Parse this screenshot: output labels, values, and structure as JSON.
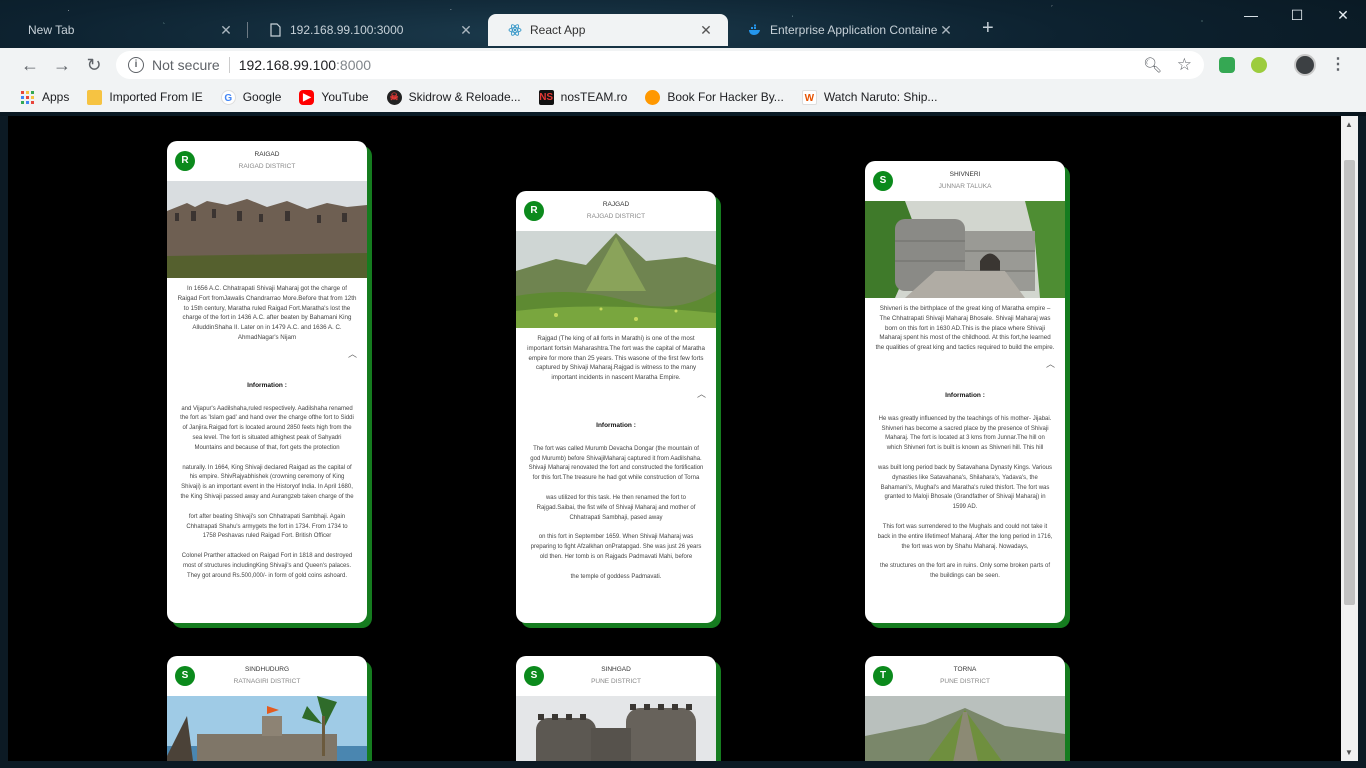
{
  "browser": {
    "tabs": [
      {
        "label": "New Tab",
        "icon": "blank-tab-icon"
      },
      {
        "label": "192.168.99.100:3000",
        "icon": "page-icon"
      },
      {
        "label": "React App",
        "icon": "react-icon"
      },
      {
        "label": "Enterprise Application Containe",
        "icon": "docker-icon"
      }
    ],
    "active_tab": 2,
    "address": {
      "security": "Not secure",
      "host": "192.168.99.100",
      "port": ":8000"
    },
    "bookmarks": [
      {
        "label": "Apps",
        "icon": "apps-grid-icon",
        "color": "#e8453c"
      },
      {
        "label": "Imported From IE",
        "icon": "folder-icon",
        "color": "#f6c342"
      },
      {
        "label": "Google",
        "icon": "google-icon",
        "color": "#4285f4"
      },
      {
        "label": "YouTube",
        "icon": "youtube-icon",
        "color": "#ff0000"
      },
      {
        "label": "Skidrow & Reloade...",
        "icon": "skull-icon",
        "color": "#b71c1c"
      },
      {
        "label": "nosTEAM.ro",
        "icon": "ns-icon",
        "color": "#d32f2f"
      },
      {
        "label": "Book For Hacker By...",
        "icon": "book-icon",
        "color": "#ff9800"
      },
      {
        "label": "Watch Naruto: Ship...",
        "icon": "w-icon",
        "color": "#e65100"
      }
    ]
  },
  "cards": [
    {
      "avatar": "R",
      "title": "RAIGAD",
      "subtitle": "RAIGAD DISTRICT",
      "image": "fort-walls-photo",
      "summary": "In 1656 A.C. Chhatrapati Shivaji Maharaj got the charge of Raigad Fort fromJawalis Chandrarrao More.Before that from 12th to 15th century, Maratha ruled Raigad Fort.Maratha's lost the charge of the fort in 1436 A.C. after beaten by Bahamani King AlluddinShaha II. Later on in 1479 A.C. and 1636 A. C. AhmadNagar's Nijam",
      "info_heading": "Information :",
      "paragraphs": [
        "and Vijapur's Aadilshaha,ruled respectively. Aadilshaha renamed the fort as 'Islam gad' and hand over the charge ofthe fort to Siddi of Janjira.Raigad fort is located around 2850 feets high from the sea level. The fort is situated athighest peak of Sahyadri Mountains and because of that, fort gets the protection",
        "naturally. In 1664, King Shivaji declared Raigad as the capital of his empire. ShivRajyabhishek (crowning ceremony of King Shivaji) is an important event in the Historyof India. In April 1680, the King Shivaji passed away and Aurangzeb taken charge of the",
        "fort after beating Shivaji's son Chhatrapati Sambhaji. Again Chhatrapati Shahu's armygets the fort in 1734. From 1734 to 1758 Peshavas ruled Raigad Fort. British Officer",
        "Colonel Prarther attacked on Raigad Fort in 1818 and destroyed most of structures includingKing Shivaji's and Queen's palaces. They got around Rs.500,000/- in form of gold coins ashoard."
      ]
    },
    {
      "avatar": "R",
      "title": "RAJGAD",
      "subtitle": "RAJGAD DISTRICT",
      "image": "green-hill-fort-photo",
      "summary": "Rajgad (The king of all forts in Marathi) is one of the most important fortsin Maharashtra.The fort was the capital of Maratha empire for more than 25 years. This wasone of the first few forts captured by Shivaji Maharaj.Rajgad is witness to the many important incidents in nascent Maratha Empire.",
      "info_heading": "Information :",
      "paragraphs": [
        "The fort was called Murumb Devacha Dongar (the mountain of god Murumb) before ShivajiMaharaj captured it from Aadilshaha. Shivaji Maharaj renovated the fort and constructed the fortification for this fort.The treasure he had got while construction of Torna",
        "was utilized for this task. He then renamed the fort to Rajgad.Saibai, the fist wife of Shivaji Maharaj and mother of Chhatrapati Sambhaji, pased away",
        "on this fort in September 1659. When Shivaji Maharaj was preparing to fight Afzalkhan onPratapgad. She was just 26 years old then. Her tomb is on Rajgads Padmavati Mahi, before",
        "the temple of goddess Padmavati."
      ]
    },
    {
      "avatar": "S",
      "title": "SHIVNERI",
      "subtitle": "JUNNAR TALUKA",
      "image": "stone-steps-photo",
      "summary": "Shivneri is the birthplace of the great king of Maratha empire – The Chhatrapati Shivaji Maharaj Bhosale. Shivaji Maharaj was born on this fort in 1630 AD.This is the place where Shivaji Maharaj spent his most of the childhood. At this fort,he learned the qualities of great king and tactics required to build the empire.",
      "info_heading": "Information :",
      "paragraphs": [
        "He was greatly influenced by the teachings of his mother- Jijabai. Shivneri has become a sacred place by the presence of Shivaji Maharaj. The fort is located at 3 kms from Junnar.The hill on which Shivneri fort is built is known as Shivneri hill. This hill",
        "was built long period back by Satavahana Dynasty Kings. Various dynasties like Satavahana's, Shilahara's, Yadava's, the Bahamani's, Mughal's and Maratha's ruled thisfort. The fort was granted to Maloji Bhosale (Grandfather of Shivaji Maharaj) in 1599 AD.",
        "This fort was surrendered to the Mughals and could not take it back in the entire lifetimeof Maharaj. After the long period in 1716, the fort was won by Shahu Maharaj. Nowadays,",
        "the structures on the fort are in ruins. Only some broken parts of the buildings can be seen."
      ]
    },
    {
      "avatar": "S",
      "title": "SINDHUDURG",
      "subtitle": "RATNAGIRI DISTRICT",
      "image": "sea-fort-photo"
    },
    {
      "avatar": "S",
      "title": "SINHGAD",
      "subtitle": "PUNE DISTRICT",
      "image": "bastion-photo"
    },
    {
      "avatar": "T",
      "title": "TORNA",
      "subtitle": "PUNE DISTRICT",
      "image": "ridge-photo"
    }
  ]
}
